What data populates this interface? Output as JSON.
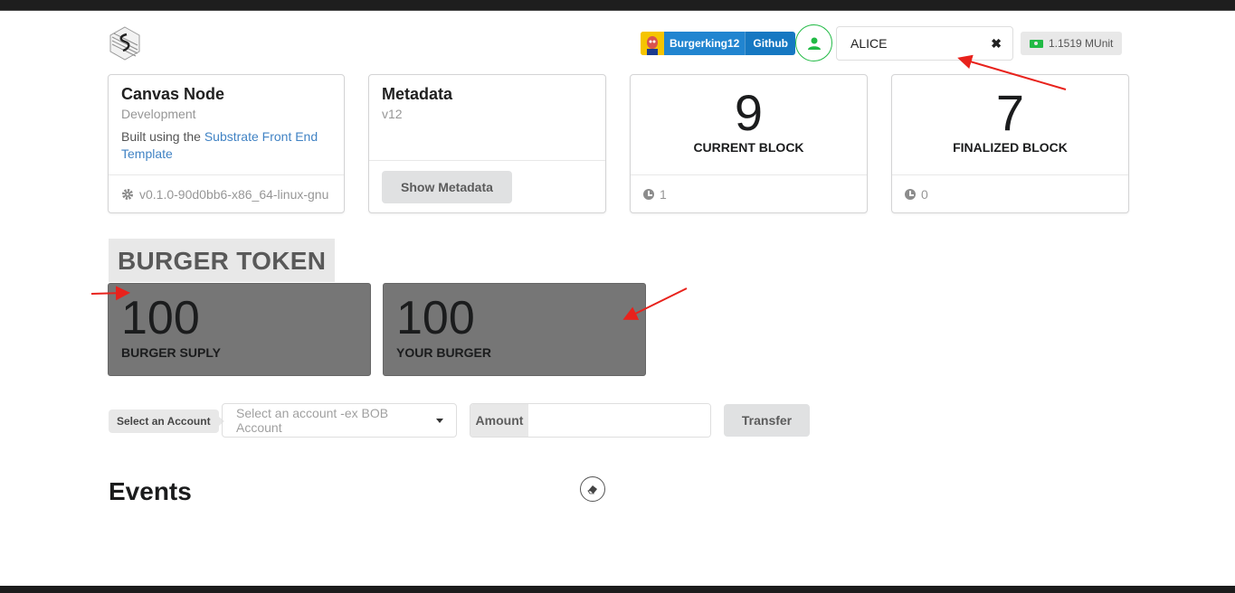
{
  "header": {
    "github": {
      "username": "Burgerking12",
      "link_label": "Github"
    },
    "account": {
      "selected": "ALICE"
    },
    "balance": "1.1519 MUnit"
  },
  "cards": {
    "node": {
      "title": "Canvas Node",
      "meta": "Development",
      "desc_prefix": "Built using the ",
      "desc_link": "Substrate Front End Template",
      "version": "v0.1.0-90d0bb6-x86_64-linux-gnu"
    },
    "metadata": {
      "title": "Metadata",
      "version": "v12",
      "button_label": "Show Metadata"
    },
    "current_block": {
      "value": "9",
      "label": "CURRENT BLOCK",
      "timer": "1"
    },
    "finalized_block": {
      "value": "7",
      "label": "FINALIZED BLOCK",
      "timer": "0"
    }
  },
  "token": {
    "title": "BURGER TOKEN",
    "supply": {
      "value": "100",
      "label": "BURGER SUPLY"
    },
    "yours": {
      "value": "100",
      "label": "YOUR BURGER"
    }
  },
  "transfer": {
    "select_label": "Select an Account",
    "dropdown_placeholder": "Select an account -ex BOB Account",
    "amount_label": "Amount",
    "amount_value": "",
    "button_label": "Transfer"
  },
  "events": {
    "title": "Events"
  },
  "colors": {
    "primary": "#2185d0",
    "green": "#21ba45",
    "annotation": "#e8221c"
  }
}
